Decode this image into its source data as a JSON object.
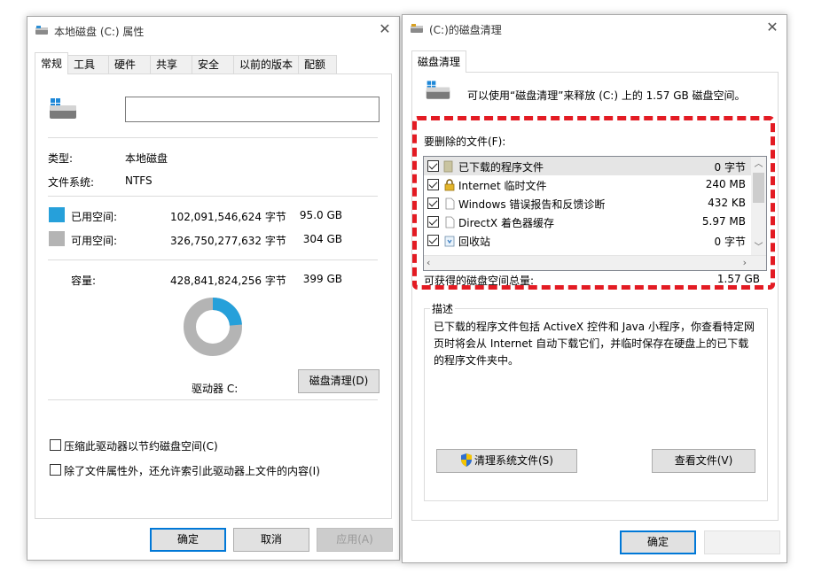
{
  "props_window": {
    "title": "本地磁盘 (C:) 属性",
    "tabs": [
      "常规",
      "工具",
      "硬件",
      "共享",
      "安全",
      "以前的版本",
      "配额"
    ],
    "name_value": "",
    "type_label": "类型:",
    "type_value": "本地磁盘",
    "fs_label": "文件系统:",
    "fs_value": "NTFS",
    "used_label": "已用空间:",
    "used_bytes": "102,091,546,624 字节",
    "used_gb": "95.0 GB",
    "free_label": "可用空间:",
    "free_bytes": "326,750,277,632 字节",
    "free_gb": "304 GB",
    "cap_label": "容量:",
    "cap_bytes": "428,841,824,256 字节",
    "cap_gb": "399 GB",
    "used_fraction": 0.238,
    "drive_label": "驱动器 C:",
    "cleanup_btn": "磁盘清理(D)",
    "compress_option": "压缩此驱动器以节约磁盘空间(C)",
    "index_option": "除了文件属性外，还允许索引此驱动器上文件的内容(I)",
    "ok": "确定",
    "cancel": "取消",
    "apply": "应用(A)",
    "colors": {
      "used": "#26a0da",
      "free": "#b4b4b4"
    }
  },
  "cleanup_window": {
    "title": "(C:)的磁盘清理",
    "tab": "磁盘清理",
    "intro": "可以使用“磁盘清理”来释放  (C:) 上的 1.57 GB 磁盘空间。",
    "files_label": "要删除的文件(F):",
    "files": [
      {
        "name": "已下载的程序文件",
        "size": "0 字节",
        "checked": true,
        "icon": "folder-icon"
      },
      {
        "name": "Internet 临时文件",
        "size": "240 MB",
        "checked": true,
        "icon": "lock-icon"
      },
      {
        "name": "Windows 错误报告和反馈诊断",
        "size": "432 KB",
        "checked": true,
        "icon": "file-icon"
      },
      {
        "name": "DirectX 着色器缓存",
        "size": "5.97 MB",
        "checked": true,
        "icon": "file-icon"
      },
      {
        "name": "回收站",
        "size": "0 字节",
        "checked": true,
        "icon": "recycle-bin-icon"
      }
    ],
    "total_label": "可获得的磁盘空间总量:",
    "total_value": "1.57 GB",
    "desc_title": "描述",
    "desc_text": "已下载的程序文件包括 ActiveX 控件和 Java 小程序，你查看特定网页时将会从 Internet 自动下载它们，并临时保存在硬盘上的已下载的程序文件夹中。",
    "clean_sys_btn": "清理系统文件(S)",
    "view_files_btn": "查看文件(V)",
    "ok": "确定"
  }
}
